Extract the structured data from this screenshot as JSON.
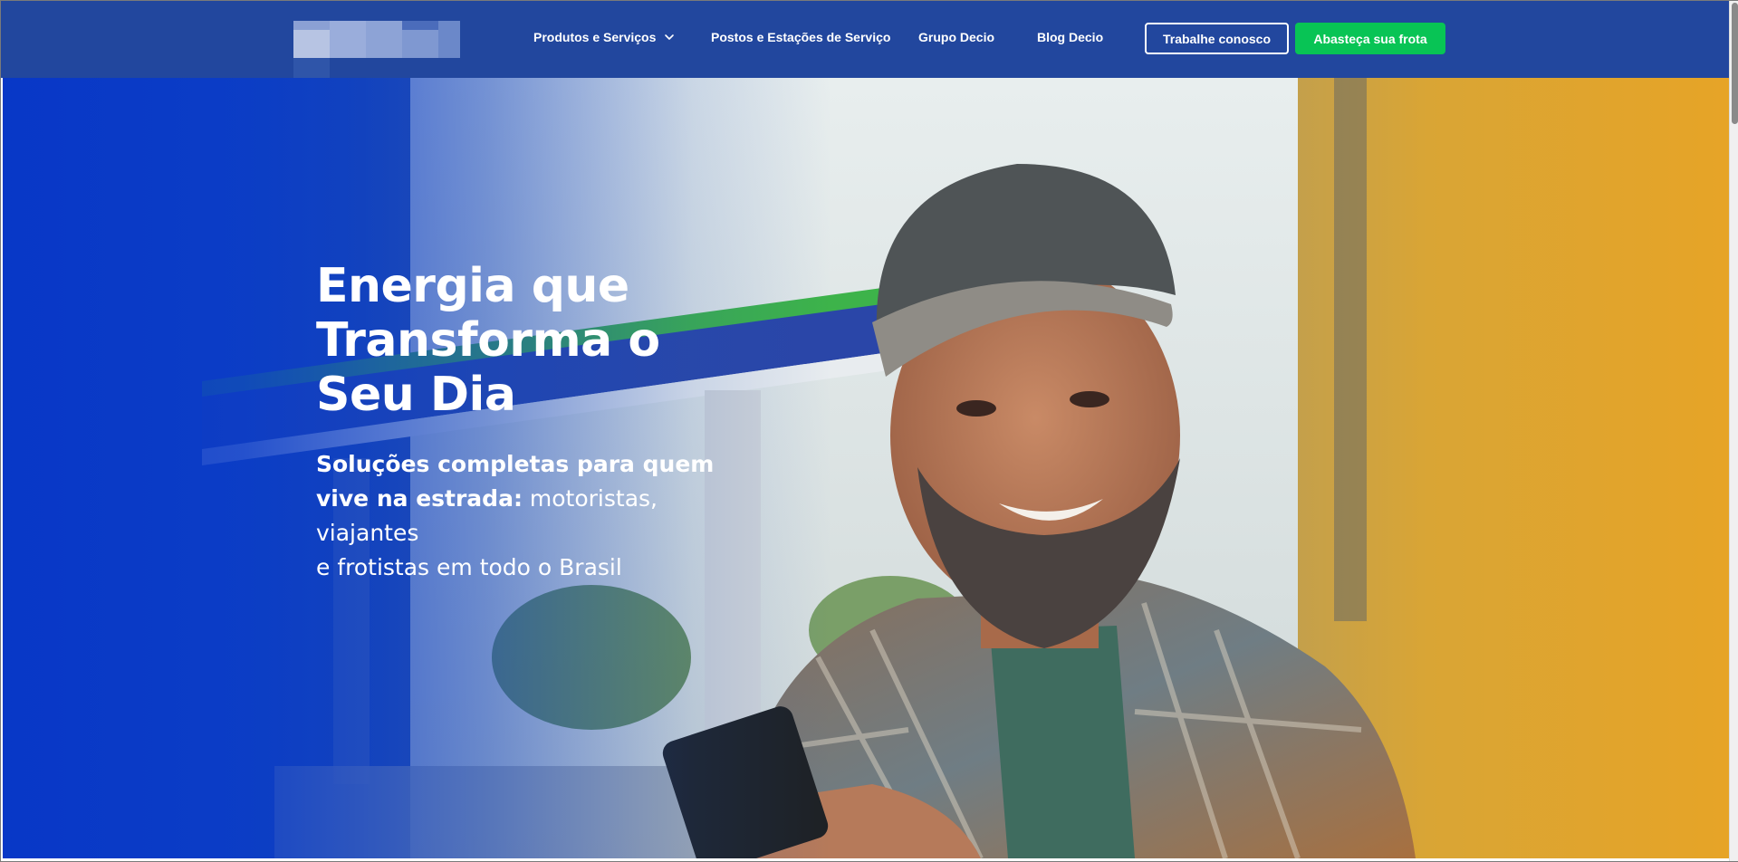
{
  "header": {
    "nav": [
      {
        "label": "Produtos e Serviços",
        "has_dropdown": true
      },
      {
        "label": "Postos e Estações de Serviço"
      },
      {
        "label": "Grupo Decio"
      },
      {
        "label": "Blog Decio"
      }
    ],
    "cta_outline": "Trabalhe conosco",
    "cta_primary": "Abasteça sua frota"
  },
  "hero": {
    "title_line1": "Energia que",
    "title_line2": "Transforma o",
    "title_line3": "Seu Dia",
    "subtitle_bold_1": "Soluções completas para quem",
    "subtitle_bold_2": "vive na estrada:",
    "subtitle_rest_1": " motoristas, viajantes",
    "subtitle_rest_2": "e frotistas em todo o Brasil"
  },
  "colors": {
    "header_bg": "#22479e",
    "primary_button": "#08c455",
    "hero_blue": "#0f3fb6",
    "hero_orange": "#e3a42b"
  },
  "icons": {
    "dropdown": "chevron-down-icon"
  }
}
